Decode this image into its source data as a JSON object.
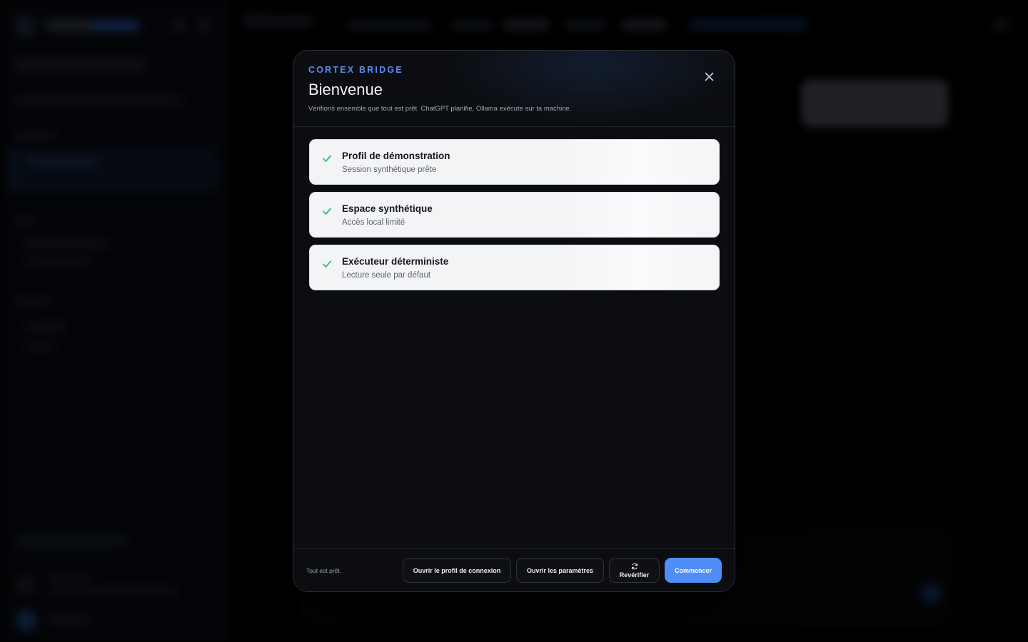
{
  "modal": {
    "eyebrow": "CORTEX BRIDGE",
    "title": "Bienvenue",
    "subtitle": "Vérifions ensemble que tout est prêt. ChatGPT planifie, Ollama exécute sur ta machine.",
    "close_icon": "close-icon",
    "checks": [
      {
        "title": "Profil de démonstration",
        "description": "Session synthétique prête",
        "status": "ok",
        "icon": "check-icon"
      },
      {
        "title": "Espace synthétique",
        "description": "Accès local limité",
        "status": "ok",
        "icon": "check-icon"
      },
      {
        "title": "Exécuteur déterministe",
        "description": "Lecture seule par défaut",
        "status": "ok",
        "icon": "check-icon"
      }
    ],
    "footer": {
      "status": "Tout est prêt.",
      "open_login_profile": "Ouvrir le profil de connexion",
      "open_settings": "Ouvrir les paramètres",
      "recheck": "Revérifier",
      "recheck_icon": "refresh-icon",
      "start": "Commencer"
    }
  },
  "colors": {
    "accent": "#4f8ef7",
    "eyebrow": "#5b8def",
    "check": "#2fbf71",
    "modal_bg": "#0b0d10"
  }
}
